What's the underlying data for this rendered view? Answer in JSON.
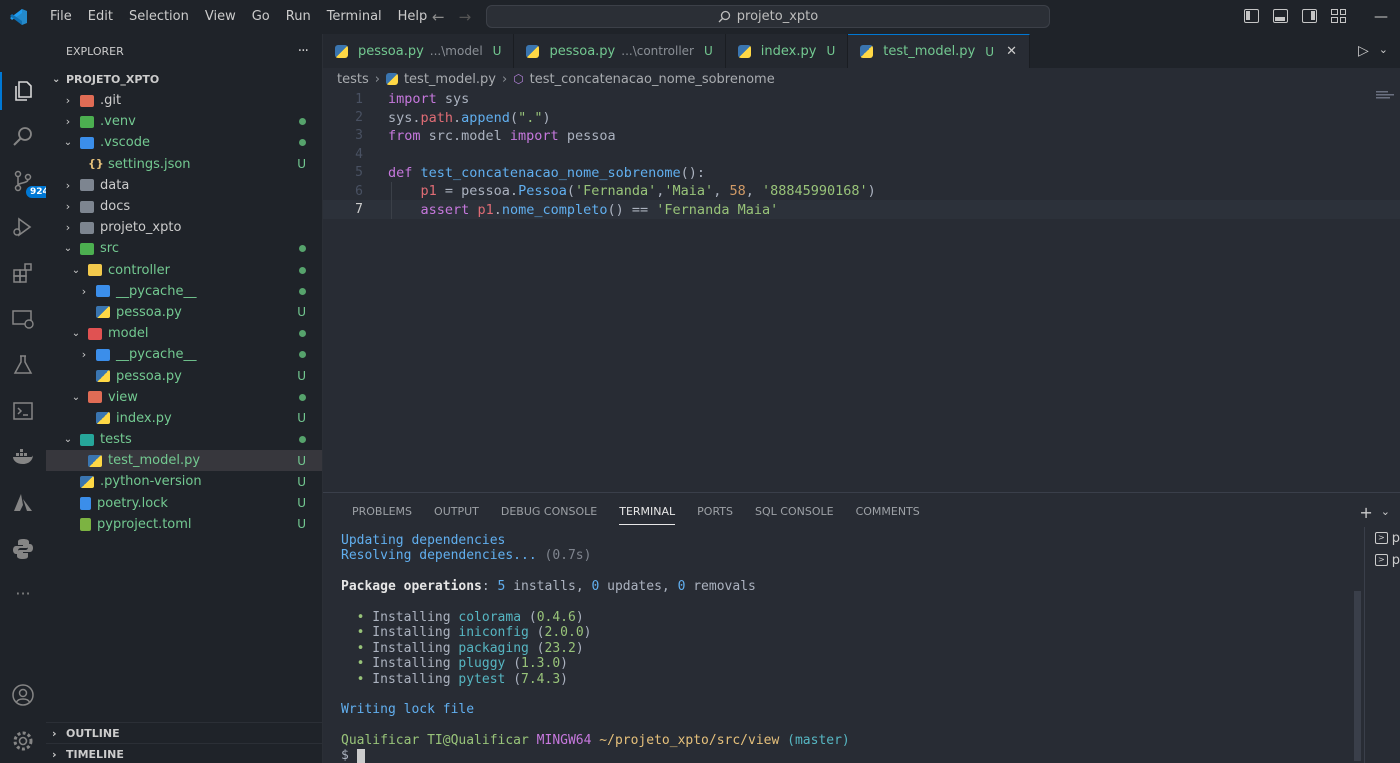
{
  "titlebar": {
    "menu": [
      "File",
      "Edit",
      "Selection",
      "View",
      "Go",
      "Run",
      "Terminal",
      "Help"
    ],
    "search_text": "projeto_xpto"
  },
  "activitybar": {
    "icons": [
      "explorer-icon",
      "search-icon",
      "source-control-icon",
      "run-debug-icon",
      "extensions-icon",
      "remote-explorer-icon",
      "testing-icon",
      "terminal-icon",
      "docker-icon",
      "azure-icon",
      "python-icon",
      "more-icon",
      "accounts-icon",
      "settings-gear-icon"
    ],
    "scm_badge": "924"
  },
  "sidebar": {
    "title": "EXPLORER",
    "more": "···",
    "root": "PROJETO_XPTO",
    "items": [
      {
        "label": ".git",
        "chev": "›",
        "indent": 0,
        "icon": "git-folder",
        "color": "#e06c55",
        "green": false,
        "mark": ""
      },
      {
        "label": ".venv",
        "chev": "›",
        "indent": 0,
        "icon": "venv-folder",
        "color": "#4caf50",
        "green": true,
        "mark": "dot"
      },
      {
        "label": ".vscode",
        "chev": "⌄",
        "indent": 0,
        "icon": "vscode-folder",
        "color": "#3b8eea",
        "green": true,
        "mark": "dot"
      },
      {
        "label": "settings.json",
        "chev": "",
        "indent": 1,
        "icon": "json-file",
        "color": "#e5c07b",
        "green": true,
        "mark": "U"
      },
      {
        "label": "data",
        "chev": "›",
        "indent": 0,
        "icon": "folder",
        "color": "#7d8590",
        "green": false,
        "mark": ""
      },
      {
        "label": "docs",
        "chev": "›",
        "indent": 0,
        "icon": "folder",
        "color": "#7d8590",
        "green": false,
        "mark": ""
      },
      {
        "label": "projeto_xpto",
        "chev": "›",
        "indent": 0,
        "icon": "folder",
        "color": "#7d8590",
        "green": false,
        "mark": ""
      },
      {
        "label": "src",
        "chev": "⌄",
        "indent": 0,
        "icon": "src-folder",
        "color": "#4caf50",
        "green": true,
        "mark": "dot"
      },
      {
        "label": "controller",
        "chev": "⌄",
        "indent": 1,
        "icon": "controller-folder",
        "color": "#f2c94c",
        "green": true,
        "mark": "dot"
      },
      {
        "label": "__pycache__",
        "chev": "›",
        "indent": 2,
        "icon": "pycache-folder",
        "color": "#3b8eea",
        "green": true,
        "mark": "dot"
      },
      {
        "label": "pessoa.py",
        "chev": "",
        "indent": 2,
        "icon": "python-file",
        "color": "#3a75b0",
        "green": true,
        "mark": "U"
      },
      {
        "label": "model",
        "chev": "⌄",
        "indent": 1,
        "icon": "model-folder",
        "color": "#e05252",
        "green": true,
        "mark": "dot"
      },
      {
        "label": "__pycache__",
        "chev": "›",
        "indent": 2,
        "icon": "pycache-folder",
        "color": "#3b8eea",
        "green": true,
        "mark": "dot"
      },
      {
        "label": "pessoa.py",
        "chev": "",
        "indent": 2,
        "icon": "python-file",
        "color": "#3a75b0",
        "green": true,
        "mark": "U"
      },
      {
        "label": "view",
        "chev": "⌄",
        "indent": 1,
        "icon": "view-folder",
        "color": "#e06c55",
        "green": true,
        "mark": "dot"
      },
      {
        "label": "index.py",
        "chev": "",
        "indent": 2,
        "icon": "python-file",
        "color": "#3a75b0",
        "green": true,
        "mark": "U"
      },
      {
        "label": "tests",
        "chev": "⌄",
        "indent": 0,
        "icon": "tests-folder",
        "color": "#26a69a",
        "green": true,
        "mark": "dot"
      },
      {
        "label": "test_model.py",
        "chev": "",
        "indent": 1,
        "icon": "python-file",
        "color": "#3a75b0",
        "green": true,
        "mark": "U",
        "selected": true
      },
      {
        "label": ".python-version",
        "chev": "",
        "indent": 0,
        "icon": "python-file",
        "color": "#3a75b0",
        "green": true,
        "mark": "U"
      },
      {
        "label": "poetry.lock",
        "chev": "",
        "indent": 0,
        "icon": "poetry-file",
        "color": "#3b8eea",
        "green": true,
        "mark": "U"
      },
      {
        "label": "pyproject.toml",
        "chev": "",
        "indent": 0,
        "icon": "toml-file",
        "color": "#7cb342",
        "green": true,
        "mark": "U"
      }
    ],
    "outline": "OUTLINE",
    "timeline": "TIMELINE"
  },
  "tabs": [
    {
      "name": "pessoa.py",
      "dir": "...\\model",
      "status": "U",
      "active": false
    },
    {
      "name": "pessoa.py",
      "dir": "...\\controller",
      "status": "U",
      "active": false
    },
    {
      "name": "index.py",
      "dir": "",
      "status": "U",
      "active": false
    },
    {
      "name": "test_model.py",
      "dir": "",
      "status": "U",
      "active": true
    }
  ],
  "breadcrumb": [
    "tests",
    "test_model.py",
    "test_concatenacao_nome_sobrenome"
  ],
  "code": [
    [
      [
        "kw",
        "import"
      ],
      [
        "plain",
        " sys"
      ]
    ],
    [
      [
        "plain",
        "sys."
      ],
      [
        "var",
        "path"
      ],
      [
        "plain",
        "."
      ],
      [
        "fn",
        "append"
      ],
      [
        "plain",
        "("
      ],
      [
        "str",
        "\".\""
      ],
      [
        "plain",
        ")"
      ]
    ],
    [
      [
        "kw",
        "from"
      ],
      [
        "plain",
        " src.model "
      ],
      [
        "kw",
        "import"
      ],
      [
        "plain",
        " pessoa"
      ]
    ],
    [],
    [
      [
        "kw",
        "def"
      ],
      [
        "plain",
        " "
      ],
      [
        "fn",
        "test_concatenacao_nome_sobrenome"
      ],
      [
        "plain",
        "():"
      ]
    ],
    [
      [
        "plain",
        "    "
      ],
      [
        "var",
        "p1"
      ],
      [
        "plain",
        " = pessoa."
      ],
      [
        "fn",
        "Pessoa"
      ],
      [
        "plain",
        "("
      ],
      [
        "str",
        "'Fernanda'"
      ],
      [
        "plain",
        ","
      ],
      [
        "str",
        "'Maia'"
      ],
      [
        "plain",
        ", "
      ],
      [
        "num",
        "58"
      ],
      [
        "plain",
        ", "
      ],
      [
        "str",
        "'88845990168'"
      ],
      [
        "plain",
        ")"
      ]
    ],
    [
      [
        "plain",
        "    "
      ],
      [
        "kw",
        "assert"
      ],
      [
        "plain",
        " "
      ],
      [
        "var",
        "p1"
      ],
      [
        "plain",
        "."
      ],
      [
        "fn",
        "nome_completo"
      ],
      [
        "plain",
        "() == "
      ],
      [
        "str",
        "'Fernanda Maia'"
      ]
    ]
  ],
  "current_line": 7,
  "panel": {
    "tabs": [
      "PROBLEMS",
      "OUTPUT",
      "DEBUG CONSOLE",
      "TERMINAL",
      "PORTS",
      "SQL CONSOLE",
      "COMMENTS"
    ],
    "active_tab": "TERMINAL",
    "terminal_lines": [
      [
        [
          "t-blue",
          "Updating dependencies"
        ]
      ],
      [
        [
          "t-blue",
          "Resolving dependencies... "
        ],
        [
          "t-gray",
          "(0.7s)"
        ]
      ],
      [],
      [
        [
          "t-bold",
          "Package operations"
        ],
        [
          "plain",
          ": "
        ],
        [
          "t-blue",
          "5"
        ],
        [
          "plain",
          " installs, "
        ],
        [
          "t-blue",
          "0"
        ],
        [
          "plain",
          " updates, "
        ],
        [
          "t-blue",
          "0"
        ],
        [
          "plain",
          " removals"
        ]
      ],
      [],
      [
        [
          "plain",
          "  "
        ],
        [
          "t-green",
          "•"
        ],
        [
          "plain",
          " Installing "
        ],
        [
          "t-cyan",
          "colorama"
        ],
        [
          "plain",
          " ("
        ],
        [
          "t-green",
          "0.4.6"
        ],
        [
          "plain",
          ")"
        ]
      ],
      [
        [
          "plain",
          "  "
        ],
        [
          "t-green",
          "•"
        ],
        [
          "plain",
          " Installing "
        ],
        [
          "t-cyan",
          "iniconfig"
        ],
        [
          "plain",
          " ("
        ],
        [
          "t-green",
          "2.0.0"
        ],
        [
          "plain",
          ")"
        ]
      ],
      [
        [
          "plain",
          "  "
        ],
        [
          "t-green",
          "•"
        ],
        [
          "plain",
          " Installing "
        ],
        [
          "t-cyan",
          "packaging"
        ],
        [
          "plain",
          " ("
        ],
        [
          "t-green",
          "23.2"
        ],
        [
          "plain",
          ")"
        ]
      ],
      [
        [
          "plain",
          "  "
        ],
        [
          "t-green",
          "•"
        ],
        [
          "plain",
          " Installing "
        ],
        [
          "t-cyan",
          "pluggy"
        ],
        [
          "plain",
          " ("
        ],
        [
          "t-green",
          "1.3.0"
        ],
        [
          "plain",
          ")"
        ]
      ],
      [
        [
          "plain",
          "  "
        ],
        [
          "t-green",
          "•"
        ],
        [
          "plain",
          " Installing "
        ],
        [
          "t-cyan",
          "pytest"
        ],
        [
          "plain",
          " ("
        ],
        [
          "t-green",
          "7.4.3"
        ],
        [
          "plain",
          ")"
        ]
      ],
      [],
      [
        [
          "t-blue",
          "Writing lock file"
        ]
      ],
      [],
      [
        [
          "t-green",
          "Qualificar TI@Qualificar "
        ],
        [
          "t-purple",
          "MINGW64 "
        ],
        [
          "t-yellow",
          "~/projeto_xpto/src/view"
        ],
        [
          "t-cyan",
          " (master)"
        ]
      ],
      [
        [
          "plain",
          "$ "
        ]
      ]
    ],
    "terminal_list": [
      "p",
      "p"
    ]
  }
}
